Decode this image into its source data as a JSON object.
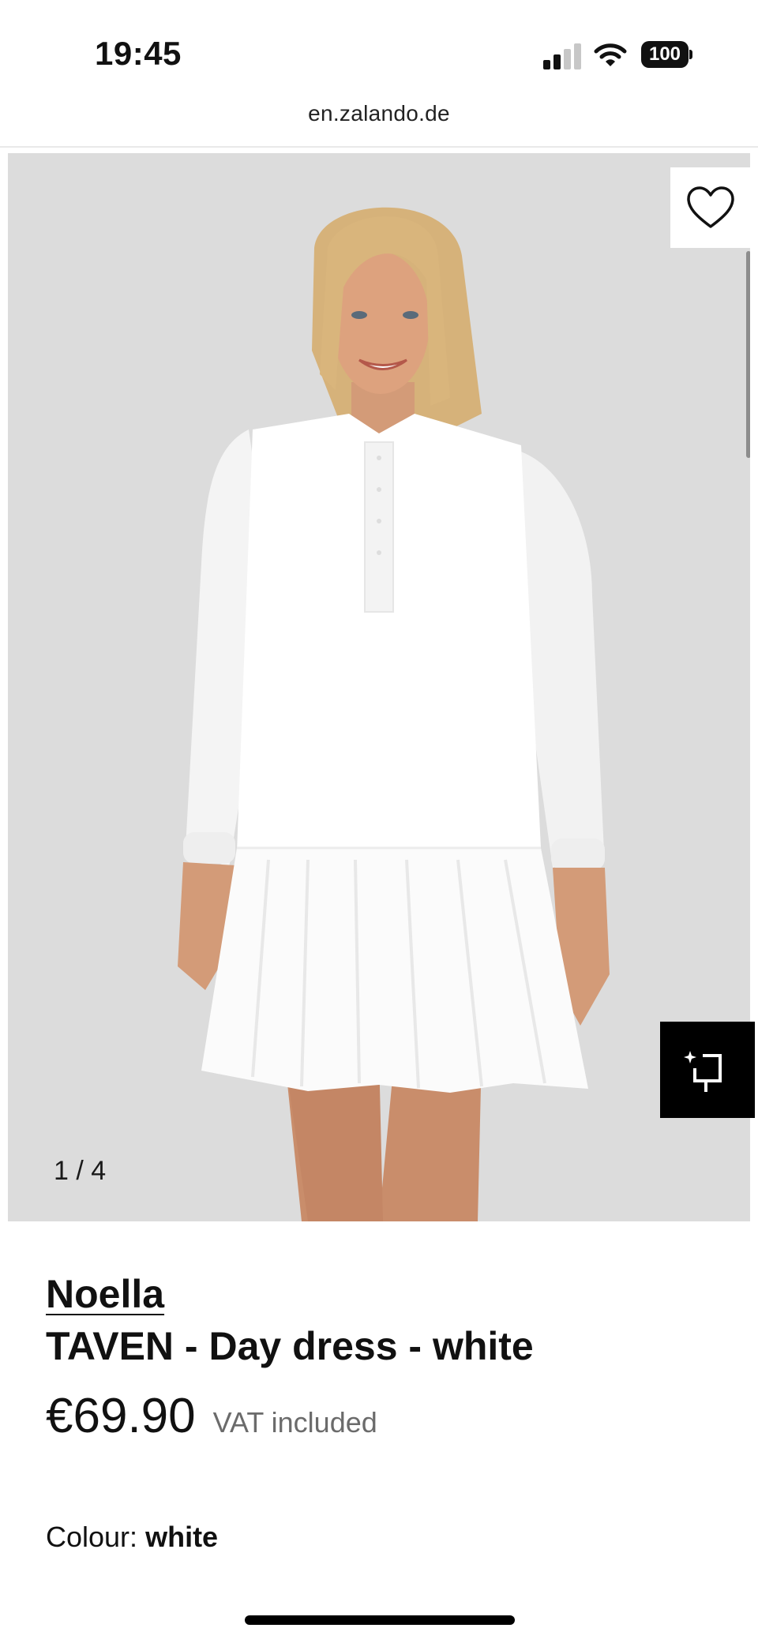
{
  "status_bar": {
    "time": "19:45",
    "battery": "100"
  },
  "browser": {
    "url": "en.zalando.de"
  },
  "gallery": {
    "counter": "1 / 4",
    "current": 1,
    "total": 4
  },
  "product": {
    "brand": "Noella",
    "name": "TAVEN - Day dress - white",
    "price": "€69.90",
    "vat_note": "VAT included",
    "colour_label": "Colour:",
    "colour_value": "white"
  },
  "icons": {
    "wishlist": "heart-icon",
    "similar": "find-similar-icon",
    "signal": "cellular-signal-icon",
    "wifi": "wifi-icon",
    "battery": "battery-icon"
  },
  "colors": {
    "image_background": "#dcdcdc",
    "dress": "#ffffff",
    "text": "#111111",
    "muted_text": "#6b6b6b"
  }
}
